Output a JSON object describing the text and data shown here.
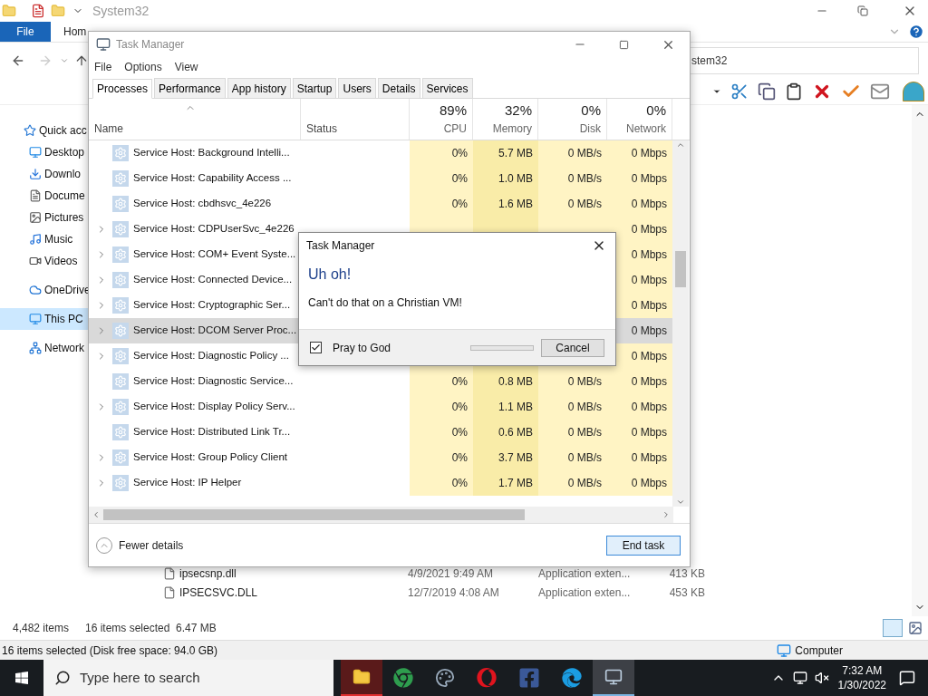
{
  "explorer": {
    "title": "System32",
    "ribbon_tabs": [
      {
        "label": "File",
        "selected": true
      },
      {
        "label": "Hom",
        "selected": false
      }
    ],
    "address": "stem32",
    "sidebar": [
      {
        "label": "Quick acc",
        "kind": "star"
      },
      {
        "label": "Desktop",
        "kind": "desktop"
      },
      {
        "label": "Downlo",
        "kind": "download"
      },
      {
        "label": "Docume",
        "kind": "document"
      },
      {
        "label": "Pictures",
        "kind": "picture"
      },
      {
        "label": "Music",
        "kind": "music"
      },
      {
        "label": "Videos",
        "kind": "video"
      },
      {
        "label": "OneDrive",
        "kind": "cloud"
      },
      {
        "label": "This PC",
        "kind": "pc",
        "selected": true
      },
      {
        "label": "Network",
        "kind": "network"
      }
    ],
    "files": [
      {
        "name": "ipsecsnp.dll",
        "date": "4/9/2021 9:49 AM",
        "type": "Application exten...",
        "size": "413 KB"
      },
      {
        "name": "IPSECSVC.DLL",
        "date": "12/7/2019 4:08 AM",
        "type": "Application exten...",
        "size": "453 KB"
      }
    ],
    "item_count": "4,482 items",
    "selection": "16 items selected  6.47 MB",
    "status_bar": "16 items selected (Disk free space: 94.0 GB)",
    "location": "Computer"
  },
  "task_manager": {
    "title": "Task Manager",
    "menu": [
      "File",
      "Options",
      "View"
    ],
    "tabs": [
      {
        "label": "Processes",
        "selected": true
      },
      {
        "label": "Performance",
        "selected": false
      },
      {
        "label": "App history",
        "selected": false
      },
      {
        "label": "Startup",
        "selected": false
      },
      {
        "label": "Users",
        "selected": false
      },
      {
        "label": "Details",
        "selected": false
      },
      {
        "label": "Services",
        "selected": false
      }
    ],
    "columns": [
      {
        "label": "Name"
      },
      {
        "label": "Status"
      },
      {
        "label": "CPU",
        "total": "89%"
      },
      {
        "label": "Memory",
        "total": "32%"
      },
      {
        "label": "Disk",
        "total": "0%"
      },
      {
        "label": "Network",
        "total": "0%"
      }
    ],
    "rows": [
      {
        "name": "Service Host: Background Intelli...",
        "expandable": false,
        "selected": false,
        "cpu": "0%",
        "memory": "5.7 MB",
        "disk": "0 MB/s",
        "network": "0 Mbps"
      },
      {
        "name": "Service Host: Capability Access ...",
        "expandable": false,
        "selected": false,
        "cpu": "0%",
        "memory": "1.0 MB",
        "disk": "0 MB/s",
        "network": "0 Mbps"
      },
      {
        "name": "Service Host: cbdhsvc_4e226",
        "expandable": false,
        "selected": false,
        "cpu": "0%",
        "memory": "1.6 MB",
        "disk": "0 MB/s",
        "network": "0 Mbps"
      },
      {
        "name": "Service Host: CDPUserSvc_4e226",
        "expandable": true,
        "selected": false,
        "network": "0 Mbps"
      },
      {
        "name": "Service Host: COM+ Event Syste...",
        "expandable": true,
        "selected": false,
        "network": "0 Mbps"
      },
      {
        "name": "Service Host: Connected Device...",
        "expandable": true,
        "selected": false,
        "network": "0 Mbps"
      },
      {
        "name": "Service Host: Cryptographic Ser...",
        "expandable": true,
        "selected": false,
        "network": "0 Mbps"
      },
      {
        "name": "Service Host: DCOM Server Proc...",
        "expandable": true,
        "selected": true,
        "network": "0 Mbps"
      },
      {
        "name": "Service Host: Diagnostic Policy ...",
        "expandable": true,
        "selected": false,
        "network": "0 Mbps"
      },
      {
        "name": "Service Host: Diagnostic Service...",
        "expandable": false,
        "selected": false,
        "cpu": "0%",
        "memory": "0.8 MB",
        "disk": "0 MB/s",
        "network": "0 Mbps"
      },
      {
        "name": "Service Host: Display Policy Serv...",
        "expandable": true,
        "selected": false,
        "cpu": "0%",
        "memory": "1.1 MB",
        "disk": "0 MB/s",
        "network": "0 Mbps"
      },
      {
        "name": "Service Host: Distributed Link Tr...",
        "expandable": false,
        "selected": false,
        "cpu": "0%",
        "memory": "0.6 MB",
        "disk": "0 MB/s",
        "network": "0 Mbps"
      },
      {
        "name": "Service Host: Group Policy Client",
        "expandable": true,
        "selected": false,
        "cpu": "0%",
        "memory": "3.7 MB",
        "disk": "0 MB/s",
        "network": "0 Mbps"
      },
      {
        "name": "Service Host: IP Helper",
        "expandable": true,
        "selected": false,
        "cpu": "0%",
        "memory": "1.7 MB",
        "disk": "0 MB/s",
        "network": "0 Mbps"
      }
    ],
    "fewer_details": "Fewer details",
    "end_task": "End task"
  },
  "dialog": {
    "title": "Task Manager",
    "heading": "Uh oh!",
    "message": "Can't do that on a Christian VM!",
    "checkbox": {
      "label": "Pray to God",
      "checked": true
    },
    "progress": {
      "level": 0
    },
    "button": "Cancel"
  },
  "taskbar": {
    "search_placeholder": "Type here to search",
    "time": "7:32 AM",
    "date": "1/30/2022"
  }
}
